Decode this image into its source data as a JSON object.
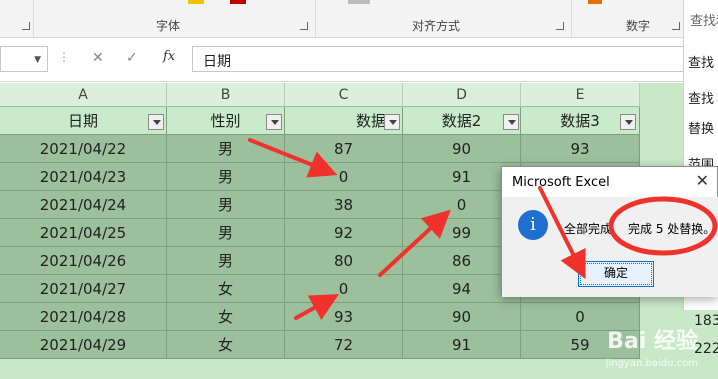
{
  "ribbon": {
    "groups": [
      "字体",
      "对齐方式",
      "数字"
    ],
    "accent_colors": [
      "#f2c200",
      "#c00000",
      "#bcbcbc",
      "#e47000"
    ]
  },
  "formula_bar": {
    "cancel_icon": "x-icon",
    "enter_icon": "check-icon",
    "fx_label": "fx",
    "value": "日期"
  },
  "sheet": {
    "column_letters": [
      "A",
      "B",
      "C",
      "D",
      "E"
    ],
    "headers": [
      "日期",
      "性别",
      "数据",
      "数据2",
      "数据3"
    ],
    "rows": [
      [
        "2021/04/22",
        "男",
        "87",
        "90",
        "93"
      ],
      [
        "2021/04/23",
        "男",
        "0",
        "91",
        ""
      ],
      [
        "2021/04/24",
        "男",
        "38",
        "0",
        ""
      ],
      [
        "2021/04/25",
        "男",
        "92",
        "99",
        ""
      ],
      [
        "2021/04/26",
        "男",
        "80",
        "86",
        ""
      ],
      [
        "2021/04/27",
        "女",
        "0",
        "94",
        ""
      ],
      [
        "2021/04/28",
        "女",
        "93",
        "90",
        "0"
      ],
      [
        "2021/04/29",
        "女",
        "72",
        "91",
        "59"
      ]
    ],
    "side_values": [
      "183",
      "222"
    ]
  },
  "find_dialog": {
    "title": "查找和",
    "items": [
      "查找",
      "查找",
      "替换",
      "范围"
    ]
  },
  "message_box": {
    "caption": "Microsoft Excel",
    "icon": "info-icon",
    "message_prefix": "全部完成",
    "message_highlight": "完成 5 处替换。",
    "ok_label": "确定"
  },
  "watermark": {
    "logo": "Bai 经验",
    "url": "jingyan.baidu.com"
  },
  "annotation_color": "#f0322c"
}
